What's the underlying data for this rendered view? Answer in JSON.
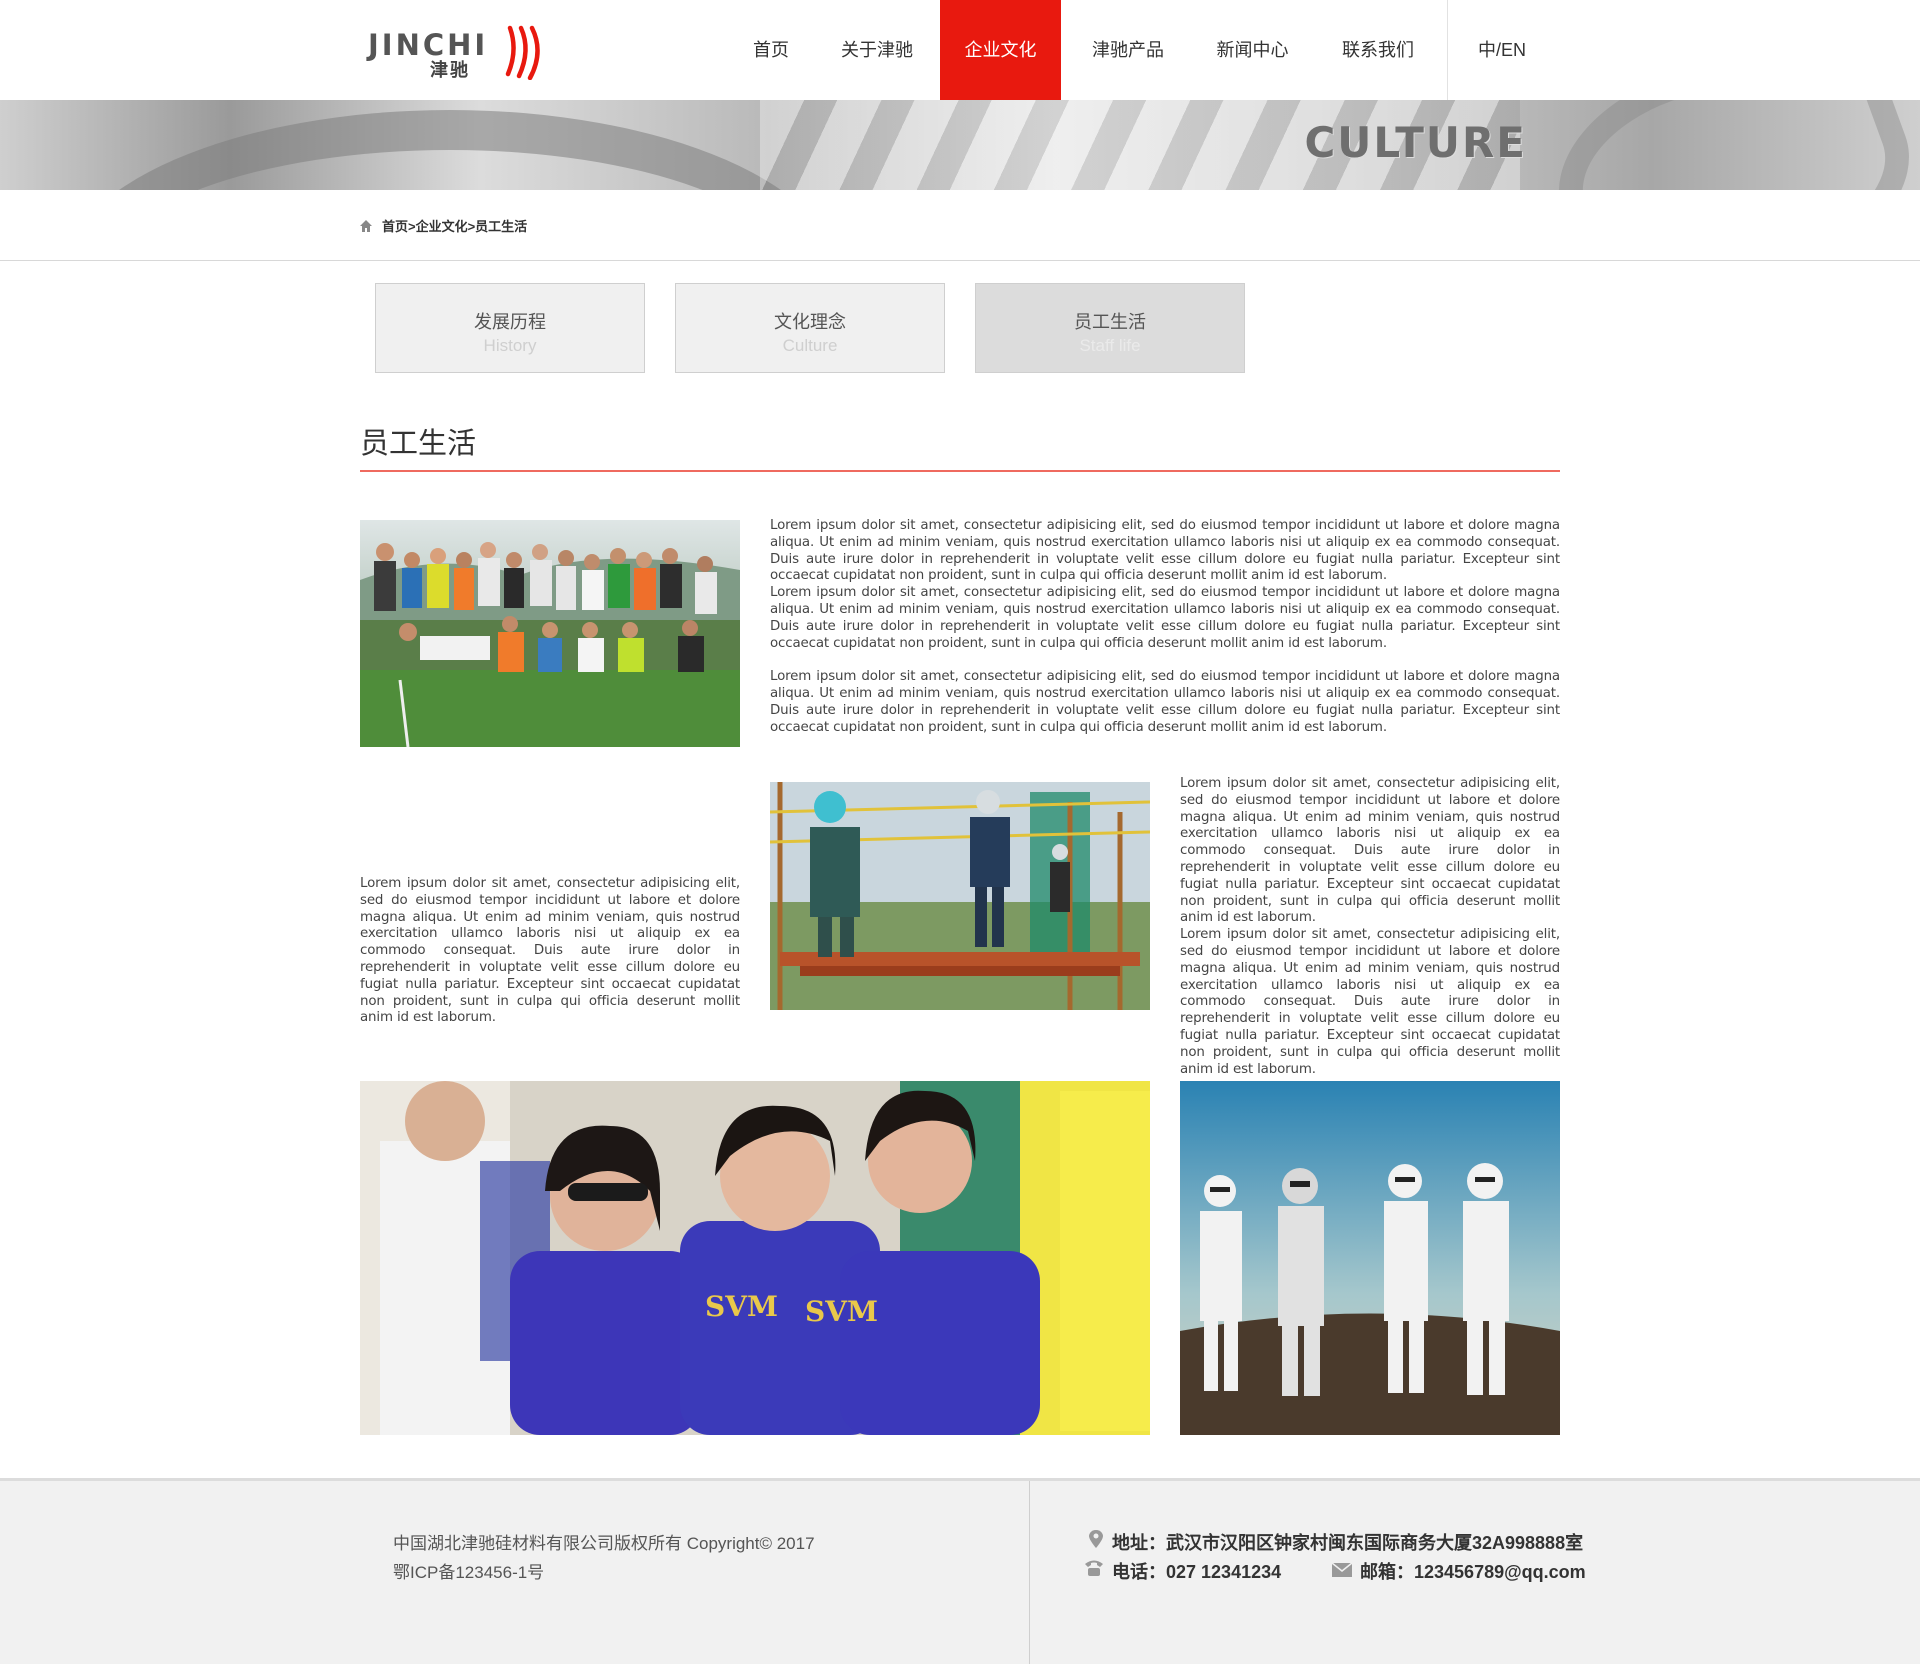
{
  "brand": {
    "logo_en": "JINCHI",
    "logo_cn": "津驰",
    "accent": "#e8190f"
  },
  "nav": {
    "items": [
      {
        "label": "首页"
      },
      {
        "label": "关于津驰"
      },
      {
        "label": "企业文化",
        "active": true
      },
      {
        "label": "津驰产品"
      },
      {
        "label": "新闻中心"
      },
      {
        "label": "联系我们"
      }
    ],
    "lang": "中/EN"
  },
  "banner": {
    "text": "CULTURE"
  },
  "breadcrumb": {
    "text": "首页>企业文化>员工生活"
  },
  "tabs": [
    {
      "cn": "发展历程",
      "en": "History"
    },
    {
      "cn": "文化理念",
      "en": "Culture"
    },
    {
      "cn": "员工生活",
      "en": "Staff life",
      "active": true
    }
  ],
  "section": {
    "title": "员工生活"
  },
  "content": {
    "block1_p1": "Lorem ipsum dolor sit amet, consectetur adipisicing elit, sed do eiusmod tempor incididunt ut labore et dolore magna aliqua. Ut enim ad minim veniam, quis nostrud exercitation ullamco laboris nisi ut aliquip ex ea commodo consequat. Duis aute irure dolor in reprehenderit in voluptate velit esse cillum dolore eu fugiat nulla pariatur. Excepteur sint occaecat cupidatat non proident, sunt in culpa qui officia deserunt mollit anim id est laborum.",
    "block1_p2": "Lorem ipsum dolor sit amet, consectetur adipisicing elit, sed do eiusmod tempor incididunt ut labore et dolore magna aliqua. Ut enim ad minim veniam, quis nostrud exercitation ullamco laboris nisi ut aliquip ex ea commodo consequat. Duis aute irure dolor in reprehenderit in voluptate velit esse cillum dolore eu fugiat nulla pariatur. Excepteur sint occaecat cupidatat non proident, sunt in culpa qui officia deserunt mollit anim id est laborum.",
    "block1_p3": "Lorem ipsum dolor sit amet, consectetur adipisicing elit, sed do eiusmod tempor incididunt ut labore et dolore magna aliqua. Ut enim ad minim veniam, quis nostrud exercitation ullamco laboris nisi ut aliquip ex ea commodo consequat. Duis aute irure dolor in reprehenderit in voluptate velit esse cillum dolore eu fugiat nulla pariatur. Excepteur sint occaecat cupidatat non proident, sunt in culpa qui officia deserunt mollit anim id est laborum.",
    "block2_left": "Lorem ipsum dolor sit amet, consectetur adipisicing elit, sed do eiusmod tempor incididunt ut labore et dolore magna aliqua. Ut enim ad minim veniam, quis nostrud exercitation ullamco laboris nisi ut aliquip ex ea commodo consequat. Duis aute irure dolor in reprehenderit in voluptate velit esse cillum dolore eu fugiat nulla pariatur. Excepteur sint occaecat cupidatat non proident, sunt in culpa qui officia deserunt mollit anim id est laborum.",
    "block2_right_p1": "Lorem ipsum dolor sit amet, consectetur adipisicing elit, sed do eiusmod tempor incididunt ut labore et dolore magna aliqua. Ut enim ad minim veniam, quis nostrud exercitation ullamco laboris nisi ut aliquip ex ea commodo consequat. Duis aute irure dolor in reprehenderit in voluptate velit esse cillum dolore eu fugiat nulla pariatur. Excepteur sint occaecat cupidatat non proident, sunt in culpa qui officia deserunt mollit anim id est laborum.",
    "block2_right_p2": "Lorem ipsum dolor sit amet, consectetur adipisicing elit, sed do eiusmod tempor incididunt ut labore et dolore magna aliqua. Ut enim ad minim veniam, quis nostrud exercitation ullamco laboris nisi ut aliquip ex ea commodo consequat. Duis aute irure dolor in reprehenderit in voluptate velit esse cillum dolore eu fugiat nulla pariatur. Excepteur sint occaecat cupidatat non proident, sunt in culpa qui officia deserunt mollit anim id est laborum.",
    "photo3_shirt": "SVM"
  },
  "footer": {
    "copyright": "中国湖北津驰硅材料有限公司版权所有 Copyright© 2017",
    "icp": "鄂ICP备123456-1号",
    "address": "地址：武汉市汉阳区钟家村闽东国际商务大厦32A998888室",
    "phone": "电话：027 12341234",
    "email": "邮箱：123456789@qq.com"
  }
}
